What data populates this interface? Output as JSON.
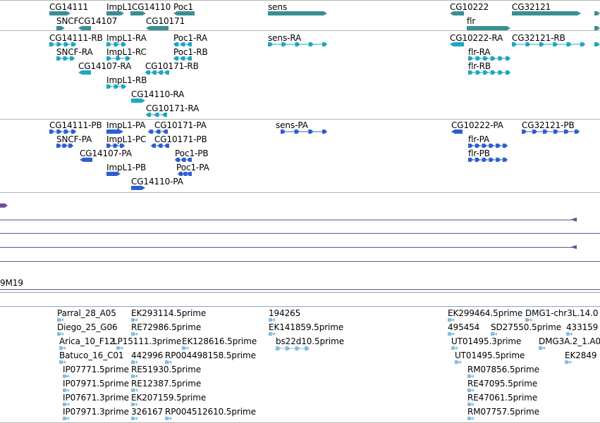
{
  "colors": {
    "gene_track": "#3a8f95",
    "transcript_track": "#1ea6c4",
    "cds_track": "#2c5fd1",
    "alignment_line": "#6d4e9c",
    "est_track": "#86bde0"
  },
  "tracks": {
    "genes": [
      {
        "label": "CG14111",
        "direction": "right"
      },
      {
        "label": "SNCF",
        "direction": "right"
      },
      {
        "label": "CG14107",
        "direction": "left"
      },
      {
        "label": "ImpL1",
        "direction": "right"
      },
      {
        "label": "CG14110",
        "direction": "right"
      },
      {
        "label": "CG10171",
        "direction": "left"
      },
      {
        "label": "Poc1",
        "direction": "left"
      },
      {
        "label": "sens",
        "direction": "right"
      },
      {
        "label": "CG10222",
        "direction": "left"
      },
      {
        "label": "flr",
        "direction": "right"
      },
      {
        "label": "CG32121",
        "direction": "right"
      }
    ],
    "transcripts": [
      {
        "label": "CG14111-RB",
        "direction": "right"
      },
      {
        "label": "SNCF-RA",
        "direction": "right"
      },
      {
        "label": "CG14107-RA",
        "direction": "left"
      },
      {
        "label": "ImpL1-RA",
        "direction": "right"
      },
      {
        "label": "ImpL1-RC",
        "direction": "right"
      },
      {
        "label": "ImpL1-RB",
        "direction": "right"
      },
      {
        "label": "CG14110-RA",
        "direction": "right"
      },
      {
        "label": "CG10171-RB",
        "direction": "left"
      },
      {
        "label": "CG10171-RA",
        "direction": "left"
      },
      {
        "label": "Poc1-RA",
        "direction": "left"
      },
      {
        "label": "Poc1-RB",
        "direction": "left"
      },
      {
        "label": "sens-RA",
        "direction": "right"
      },
      {
        "label": "CG10222-RA",
        "direction": "left"
      },
      {
        "label": "flr-RA",
        "direction": "right"
      },
      {
        "label": "flr-RB",
        "direction": "right"
      },
      {
        "label": "CG32121-RB",
        "direction": "right"
      }
    ],
    "proteins": [
      {
        "label": "CG14111-PB",
        "direction": "right"
      },
      {
        "label": "SNCF-PA",
        "direction": "right"
      },
      {
        "label": "CG14107-PA",
        "direction": "left"
      },
      {
        "label": "ImpL1-PA",
        "direction": "right"
      },
      {
        "label": "ImpL1-PC",
        "direction": "right"
      },
      {
        "label": "ImpL1-PB",
        "direction": "right"
      },
      {
        "label": "CG14110-PA",
        "direction": "right"
      },
      {
        "label": "CG10171-PA",
        "direction": "left"
      },
      {
        "label": "CG10171-PB",
        "direction": "left"
      },
      {
        "label": "Poc1-PB",
        "direction": "left"
      },
      {
        "label": "Poc1-PA",
        "direction": "left"
      },
      {
        "label": "sens-PA",
        "direction": "right"
      },
      {
        "label": "CG10222-PA",
        "direction": "left"
      },
      {
        "label": "flr-PA",
        "direction": "right"
      },
      {
        "label": "flr-PB",
        "direction": "right"
      },
      {
        "label": "CG32121-PB",
        "direction": "right"
      }
    ],
    "clone_label": "9M19",
    "ests": [
      {
        "label": "Parral_28_A05"
      },
      {
        "label": "Diego_25_G06"
      },
      {
        "label": "Arica_10_F12"
      },
      {
        "label": "Batuco_16_C01"
      },
      {
        "label": "LP15111.3prime"
      },
      {
        "label": "EK293114.5prime"
      },
      {
        "label": "RE72986.5prime"
      },
      {
        "label": "EK128616.5prime"
      },
      {
        "label": "442996"
      },
      {
        "label": "RP004498158.5prime"
      },
      {
        "label": "IP07771.5prime"
      },
      {
        "label": "RE51930.5prime"
      },
      {
        "label": "IP07971.5prime"
      },
      {
        "label": "RE12387.5prime"
      },
      {
        "label": "IP07671.3prime"
      },
      {
        "label": "EK207159.5prime"
      },
      {
        "label": "IP07971.3prime"
      },
      {
        "label": "326167"
      },
      {
        "label": "RP004512610.5prime"
      },
      {
        "label": "194265"
      },
      {
        "label": "EK141859.5prime"
      },
      {
        "label": "bs22d10.5prime"
      },
      {
        "label": "EK299464.5prime"
      },
      {
        "label": "DMG1-chr3L.14.0"
      },
      {
        "label": "495454"
      },
      {
        "label": "SD27550.5prime"
      },
      {
        "label": "433159"
      },
      {
        "label": "UT01495.3prime"
      },
      {
        "label": "UT01495.5prime"
      },
      {
        "label": "DMG3A.2_1.A0"
      },
      {
        "label": "EK2849"
      },
      {
        "label": "RM07856.5prime"
      },
      {
        "label": "RE47095.5prime"
      },
      {
        "label": "RE47061.5prime"
      },
      {
        "label": "RM07757.5prime"
      }
    ]
  }
}
